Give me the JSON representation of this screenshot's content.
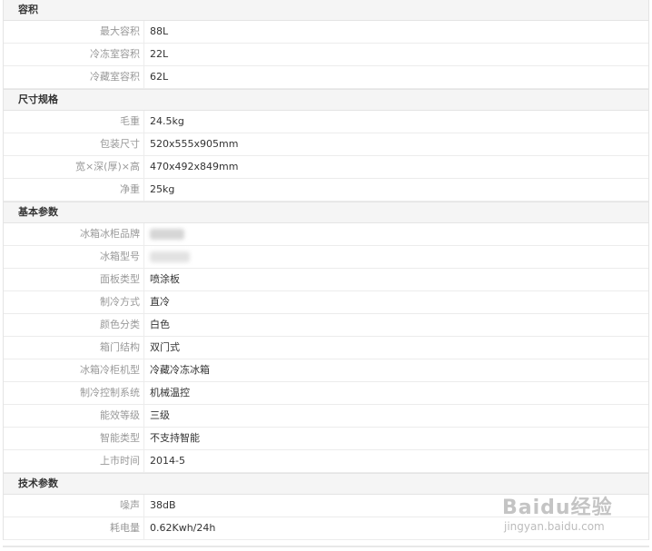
{
  "sections": [
    {
      "title": "容积",
      "rows": [
        {
          "label": "最大容积",
          "value": "88L"
        },
        {
          "label": "冷冻室容积",
          "value": "22L"
        },
        {
          "label": "冷藏室容积",
          "value": "62L"
        }
      ]
    },
    {
      "title": "尺寸规格",
      "rows": [
        {
          "label": "毛重",
          "value": "24.5kg"
        },
        {
          "label": "包装尺寸",
          "value": "520x555x905mm"
        },
        {
          "label": "宽×深(厚)×高",
          "value": "470x492x849mm"
        },
        {
          "label": "净重",
          "value": "25kg"
        }
      ]
    },
    {
      "title": "基本参数",
      "rows": [
        {
          "label": "冰箱冰柜品牌",
          "value": "",
          "blurred": true
        },
        {
          "label": "冰箱型号",
          "value": "",
          "blurred": true
        },
        {
          "label": "面板类型",
          "value": "喷涂板"
        },
        {
          "label": "制冷方式",
          "value": "直冷"
        },
        {
          "label": "颜色分类",
          "value": "白色"
        },
        {
          "label": "箱门结构",
          "value": "双门式"
        },
        {
          "label": "冰箱冷柜机型",
          "value": "冷藏冷冻冰箱"
        },
        {
          "label": "制冷控制系统",
          "value": "机械温控"
        },
        {
          "label": "能效等级",
          "value": "三级"
        },
        {
          "label": "智能类型",
          "value": "不支持智能"
        },
        {
          "label": "上市时间",
          "value": "2014-5"
        }
      ]
    },
    {
      "title": "技术参数",
      "rows": [
        {
          "label": "噪声",
          "value": "38dB"
        },
        {
          "label": "耗电量",
          "value": "0.62Kwh/24h"
        }
      ]
    }
  ],
  "watermark": {
    "logo_text": "Baidu经验",
    "url_text": "jingyan.baidu.com"
  }
}
